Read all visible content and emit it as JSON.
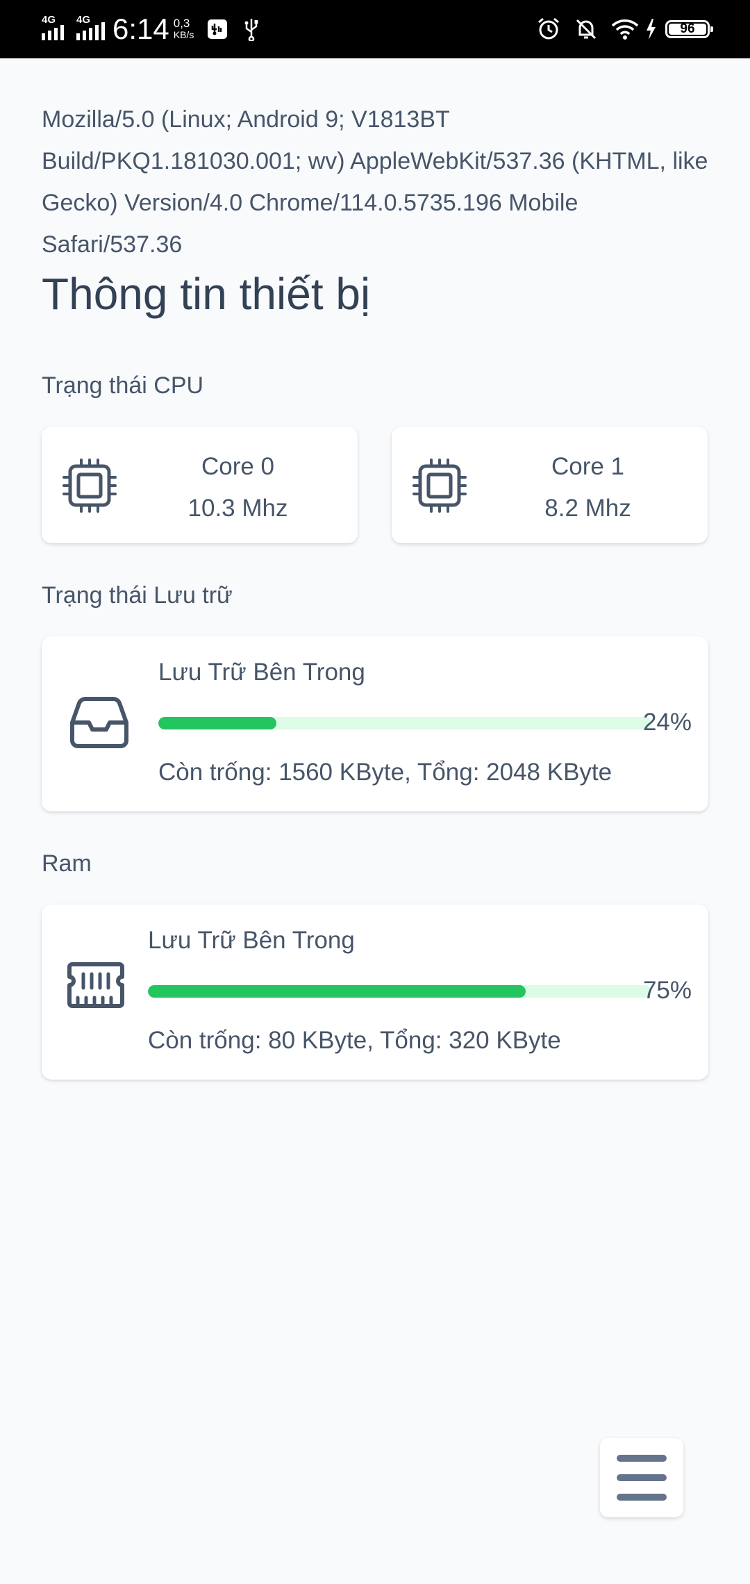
{
  "status_bar": {
    "network_1": "4G",
    "network_2": "4G",
    "time": "6:14",
    "speed_value": "0,3",
    "speed_unit": "KB/s",
    "battery": "96",
    "icons": [
      "usb-debug-icon",
      "usb-icon",
      "alarm-icon",
      "bell-off-icon",
      "wifi-icon",
      "charging-icon",
      "battery-icon"
    ]
  },
  "user_agent": "Mozilla/5.0 (Linux; Android 9; V1813BT Build/PKQ1.181030.001; wv) AppleWebKit/537.36 (KHTML, like Gecko) Version/4.0 Chrome/114.0.5735.196 Mobile Safari/537.36",
  "page_title": "Thông tin thiết bị",
  "cpu": {
    "label": "Trạng thái CPU",
    "cores": [
      {
        "name": "Core 0",
        "freq": "10.3 Mhz",
        "icon": "cpu-chip-icon"
      },
      {
        "name": "Core 1",
        "freq": "8.2 Mhz",
        "icon": "cpu-chip-icon"
      }
    ]
  },
  "storage": {
    "label": "Trạng thái Lưu trữ",
    "name": "Lưu Trữ Bên Trong",
    "percent": 24,
    "percent_label": "24%",
    "detail": "Còn trống: 1560 KByte, Tổng: 2048 KByte",
    "icon": "inbox-tray-icon"
  },
  "ram": {
    "label": "Ram",
    "name": "Lưu Trữ Bên Trong",
    "percent": 75,
    "percent_label": "75%",
    "detail": "Còn trống: 80 KByte, Tổng: 320 KByte",
    "icon": "memory-module-icon"
  },
  "colors": {
    "progress_fill": "#22c55e",
    "progress_track": "#dcfce7",
    "background": "#f8fafc",
    "text": "#475569"
  },
  "menu_button": {
    "icon": "hamburger-menu-icon"
  }
}
